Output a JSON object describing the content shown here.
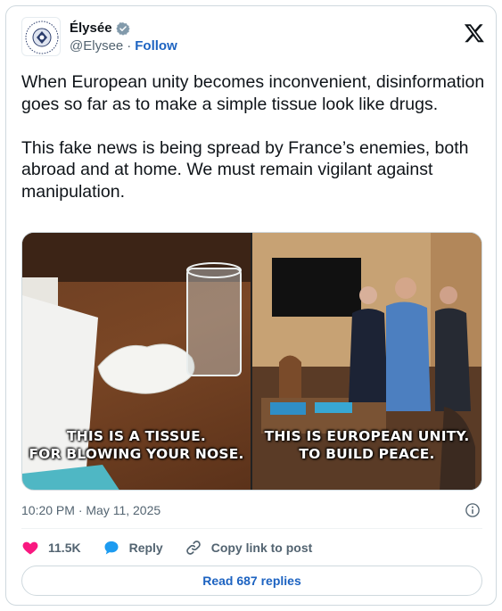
{
  "author": {
    "display_name": "Élysée",
    "handle": "@Elysee",
    "separator": "·",
    "follow_label": "Follow",
    "verified_badge": "gray-verified-badge-icon"
  },
  "post": {
    "text": "When European unity becomes inconvenient, disinformation goes so far as to make a simple tissue look like drugs.\n\nThis fake news is being spread by France’s enemies, both abroad and at home. We must remain vigilant against manipulation.",
    "timestamp": "10:20 PM · May 11, 2025"
  },
  "media": [
    {
      "caption_line1": "THIS IS A TISSUE.",
      "caption_line2": "FOR BLOWING YOUR NOSE."
    },
    {
      "caption_line1": "THIS IS EUROPEAN UNITY.",
      "caption_line2": "TO BUILD PEACE."
    }
  ],
  "actions": {
    "like_count": "11.5K",
    "reply_label": "Reply",
    "copy_link_label": "Copy link to post"
  },
  "read_replies_label": "Read 687 replies",
  "colors": {
    "accent": "#1d63c1",
    "like": "#f91880",
    "reply": "#1d9bf0",
    "muted_text": "#536471",
    "border": "#cfd9de"
  }
}
